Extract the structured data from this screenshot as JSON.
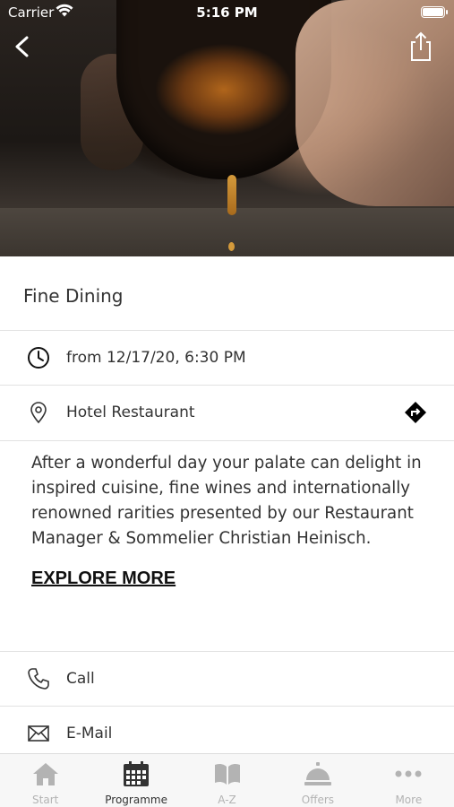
{
  "status_bar": {
    "carrier": "Carrier",
    "time": "5:16 PM"
  },
  "event": {
    "title": "Fine Dining",
    "date": "from 12/17/20, 6:30 PM",
    "location": "Hotel Restaurant",
    "description": "After a wonderful day your palate can delight in inspired cuisine, fine wines and internationally renowned rarities presented by our Restaurant Manager & Sommelier Christian Heinisch.",
    "explore_label": "EXPLORE MORE"
  },
  "contacts": {
    "call_label": "Call",
    "email_label": "E-Mail"
  },
  "tabs": [
    {
      "label": "Start",
      "icon": "house-icon",
      "active": false
    },
    {
      "label": "Programme",
      "icon": "calendar-icon",
      "active": true
    },
    {
      "label": "A-Z",
      "icon": "book-icon",
      "active": false
    },
    {
      "label": "Offers",
      "icon": "service-bell-icon",
      "active": false
    },
    {
      "label": "More",
      "icon": "more-dots-icon",
      "active": false
    }
  ],
  "colors": {
    "active_tab": "#333333",
    "inactive_tab": "#b3b3b3",
    "divider": "#e2e2e2"
  }
}
